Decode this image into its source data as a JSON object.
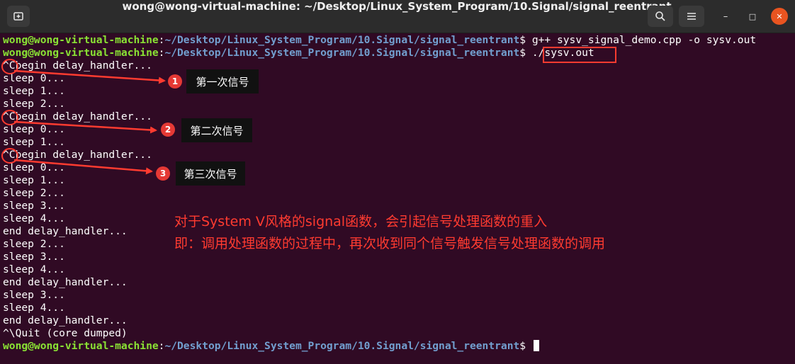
{
  "window": {
    "title": "wong@wong-virtual-machine: ~/Desktop/Linux_System_Program/10.Signal/signal_reentrant",
    "new_tab_icon": "new-tab-icon",
    "search_icon": "search-icon",
    "menu_icon": "hamburger-menu-icon",
    "minimize_glyph": "–",
    "maximize_glyph": "□",
    "close_glyph": "✕"
  },
  "prompt": {
    "user_host": "wong@wong-virtual-machine",
    "path": "~/Desktop/Linux_System_Program/10.Signal/signal_reentrant"
  },
  "commands": [
    "g++ sysv_signal_demo.cpp -o sysv.out",
    "./sysv.out"
  ],
  "output_lines": [
    "^Cbegin delay_handler...",
    "sleep 0...",
    "sleep 1...",
    "sleep 2...",
    "^Cbegin delay_handler...",
    "sleep 0...",
    "sleep 1...",
    "^Cbegin delay_handler...",
    "sleep 0...",
    "sleep 1...",
    "sleep 2...",
    "sleep 3...",
    "sleep 4...",
    "end delay_handler...",
    "sleep 2...",
    "sleep 3...",
    "sleep 4...",
    "end delay_handler...",
    "sleep 3...",
    "sleep 4...",
    "end delay_handler...",
    "^\\Quit (core dumped)"
  ],
  "annotations": {
    "labels": [
      {
        "number": "1",
        "text": "第一次信号"
      },
      {
        "number": "2",
        "text": "第二次信号"
      },
      {
        "number": "3",
        "text": "第三次信号"
      }
    ],
    "note_line1": "对于System V风格的signal函数，会引起信号处理函数的重入",
    "note_line2": "即：调用处理函数的过程中，再次收到同个信号触发信号处理函数的调用",
    "color": "#ff3b30"
  }
}
